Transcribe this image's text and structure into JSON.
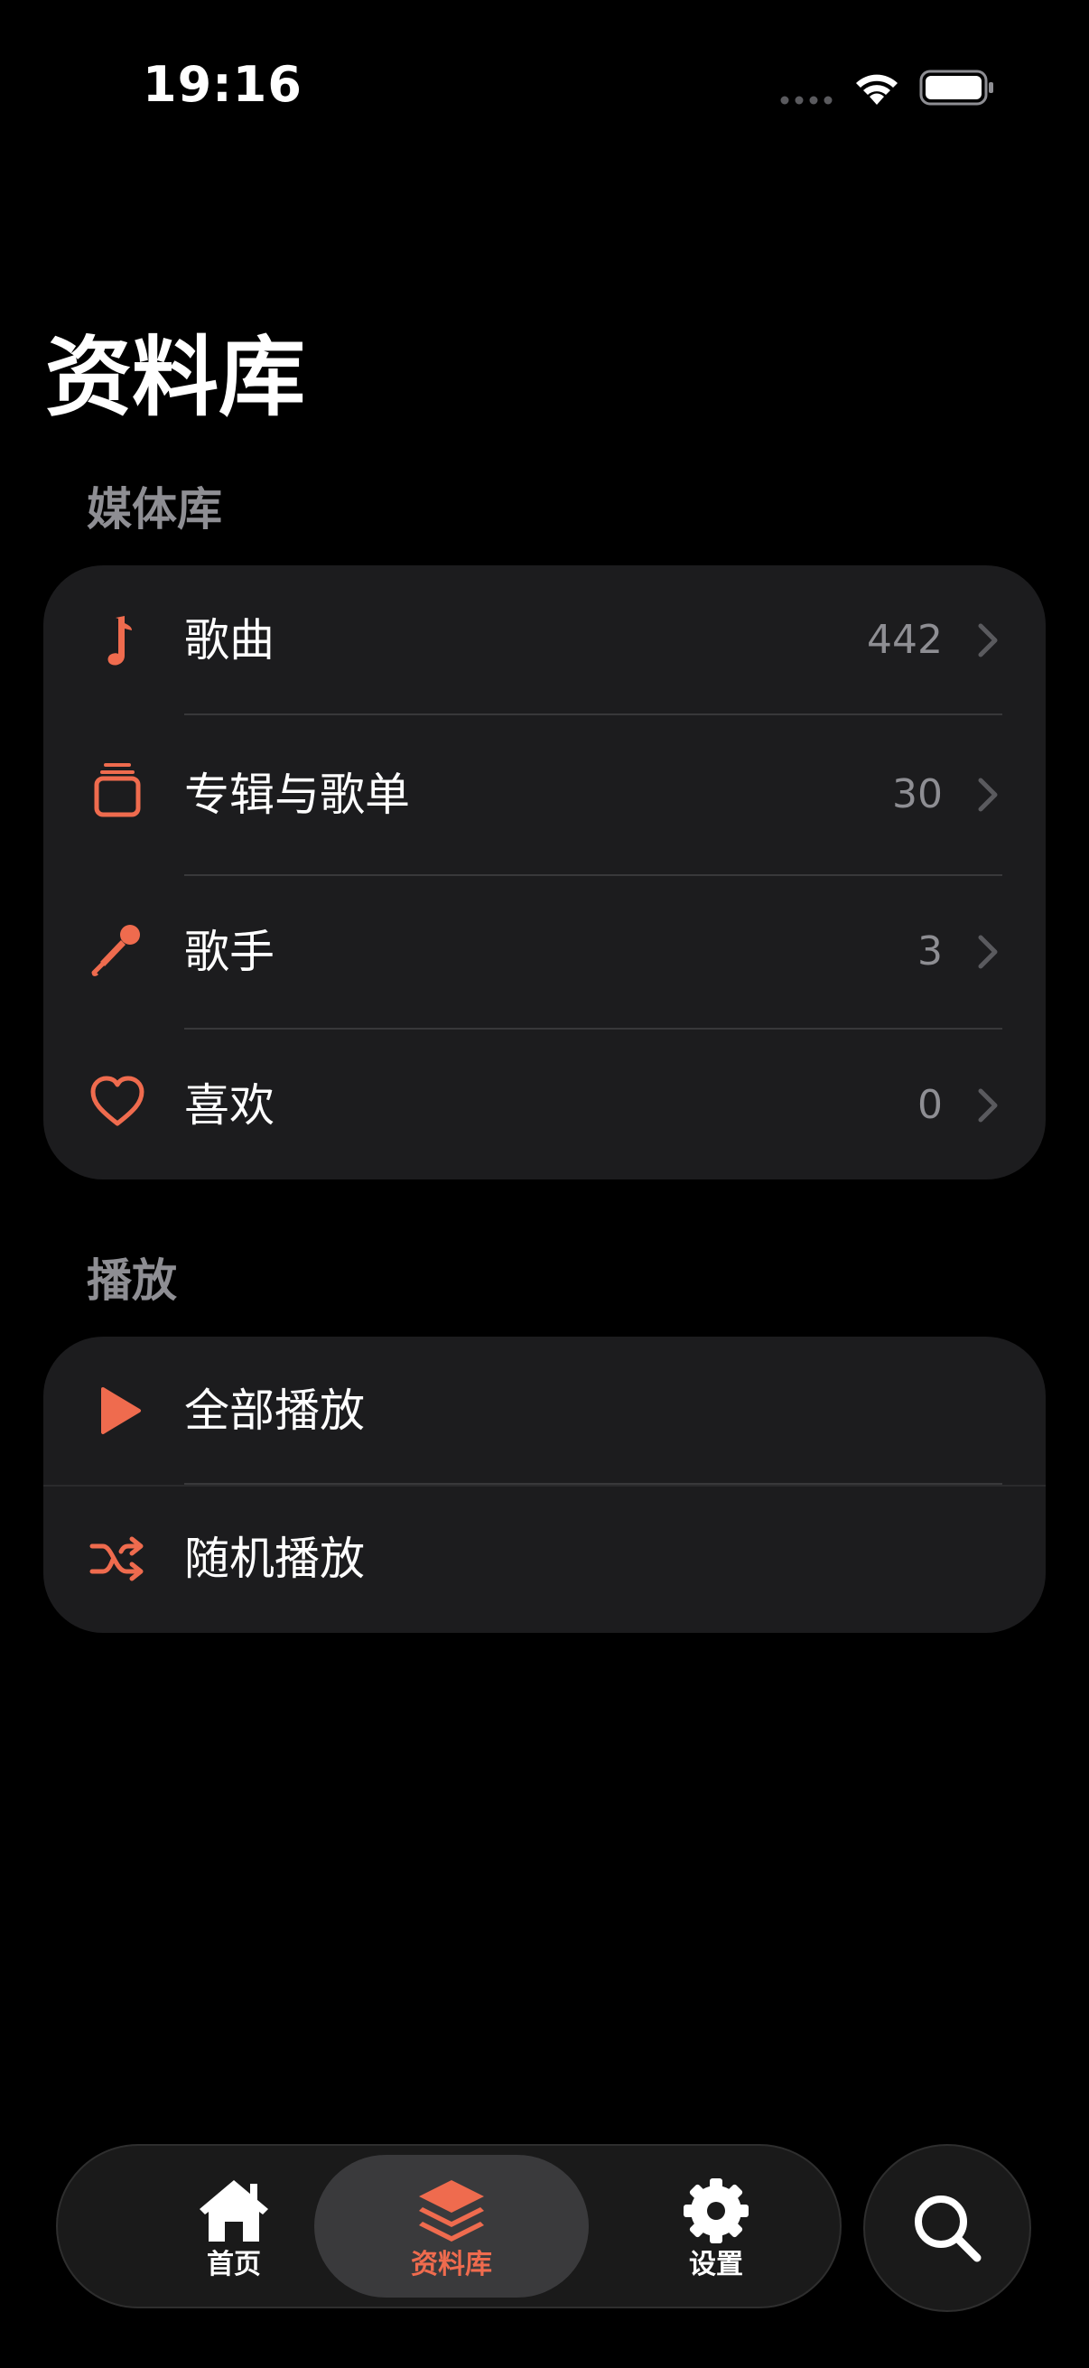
{
  "status_bar": {
    "time": "19:16"
  },
  "page": {
    "title": "资料库"
  },
  "sections": {
    "library": {
      "header": "媒体库",
      "items": [
        {
          "label": "歌曲",
          "count": "442",
          "icon": "music-note-icon"
        },
        {
          "label": "专辑与歌单",
          "count": "30",
          "icon": "album-stack-icon"
        },
        {
          "label": "歌手",
          "count": "3",
          "icon": "microphone-icon"
        },
        {
          "label": "喜欢",
          "count": "0",
          "icon": "heart-icon"
        }
      ]
    },
    "playback": {
      "header": "播放",
      "items": [
        {
          "label": "全部播放",
          "icon": "play-icon"
        },
        {
          "label": "随机播放",
          "icon": "shuffle-icon"
        }
      ]
    }
  },
  "tab_bar": {
    "tabs": [
      {
        "label": "首页",
        "icon": "house-icon",
        "active": false
      },
      {
        "label": "资料库",
        "icon": "layers-icon",
        "active": true
      },
      {
        "label": "设置",
        "icon": "gear-icon",
        "active": false
      }
    ],
    "search_icon": "search-icon"
  },
  "colors": {
    "accent": "#ef6b4e",
    "background": "#000000",
    "card": "#1c1c1e",
    "secondary_text": "#8e8e93",
    "active_tab_bg": "#3a3a3c"
  }
}
